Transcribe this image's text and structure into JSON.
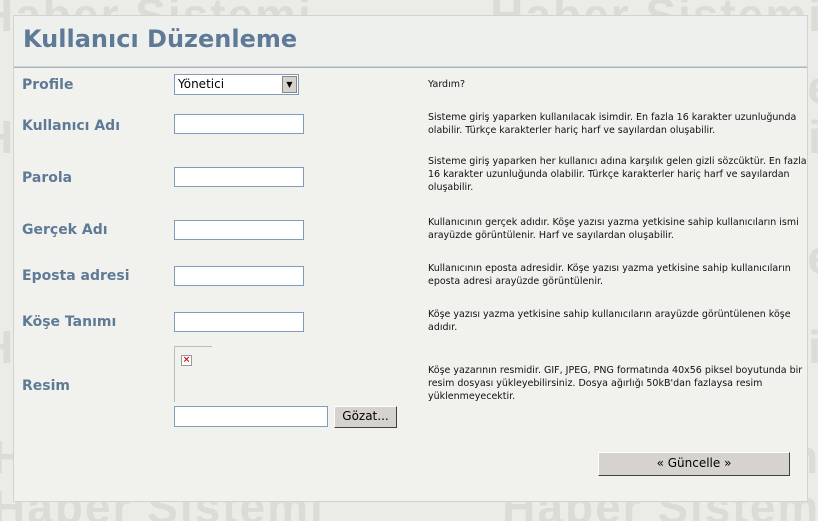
{
  "watermark": "Haber Sistemi",
  "page": {
    "title": "Kullanıcı Düzenleme"
  },
  "help_header": "Yardım?",
  "form": {
    "profile": {
      "label": "Profile",
      "selected": "Yönetici"
    },
    "username": {
      "label": "Kullanıcı Adı",
      "value": ""
    },
    "password": {
      "label": "Parola",
      "value": ""
    },
    "realname": {
      "label": "Gerçek Adı",
      "value": ""
    },
    "email": {
      "label": "Eposta adresi",
      "value": ""
    },
    "column": {
      "label": "Köşe Tanımı",
      "value": ""
    },
    "picture": {
      "label": "Resim",
      "browse_label": "Gözat..."
    }
  },
  "help": {
    "username": "Sisteme giriş yaparken kullanılacak isimdir. En fazla 16 karakter uzunluğunda olabilir. Türkçe karakterler hariç harf ve sayılardan oluşabilir.",
    "password": "Sisteme giriş yaparken her kullanıcı adına karşılık gelen gizli sözcüktür. En fazla 16 karakter uzunluğunda olabilir. Türkçe karakterler hariç harf ve sayılardan oluşabilir.",
    "realname": "Kullanıcının gerçek adıdır. Köşe yazısı yazma yetkisine sahip kullanıcıların ismi arayüzde görüntülenir. Harf ve sayılardan oluşabilir.",
    "email": "Kullanıcının eposta adresidir. Köşe yazısı yazma yetkisine sahip kullanıcıların eposta adresi arayüzde görüntülenir.",
    "column": "Köşe yazısı yazma yetkisine sahip kullanıcıların arayüzde görüntülenen köşe adıdır.",
    "picture": "Köşe yazarının resmidir. GIF, JPEG, PNG formatında 40x56 piksel boyutunda bir resim dosyası yükleyebilirsiniz. Dosya ağırlığı 50kB'dan fazlaysa resim yüklenmeyecektir."
  },
  "update_label": "«  Güncelle  »"
}
